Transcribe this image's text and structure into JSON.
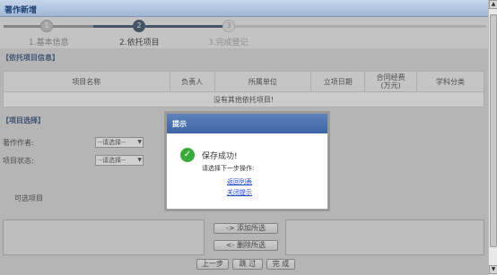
{
  "window": {
    "title": "著作新增"
  },
  "steps": [
    {
      "num": "1",
      "label": "1.基本信息"
    },
    {
      "num": "2",
      "label": "2.依托项目"
    },
    {
      "num": "3",
      "label": "3.完成登记"
    }
  ],
  "projects_section": {
    "title": "【依托项目信息】",
    "columns": [
      "项目名称",
      "负责人",
      "所属单位",
      "立项日期",
      "合同经费\n(万元)",
      "学科分类"
    ],
    "empty_text": "没有其他依托项目!"
  },
  "selection_section": {
    "title": "【项目选择】",
    "author_label": "著作作者:",
    "author_select": "--请选择--",
    "status_label": "项目状态:",
    "status_select": "--请选择--",
    "candidate_label": "可选项目"
  },
  "transfer": {
    "add_label": "-> 添加所选",
    "remove_label": "<- 删除所选"
  },
  "footer": {
    "prev_label": "上一步",
    "skip_label": "跳 过",
    "done_label": "完 成"
  },
  "dialog": {
    "title": "提示",
    "message": "保存成功!",
    "sub": "请选择下一步操作:",
    "link_return": "返回列表",
    "link_close": "关闭提示"
  },
  "colors": {
    "accent": "#1d3f73",
    "step_active": "#2a3f5f",
    "success": "#3aaa3a",
    "link": "#1d47c7"
  }
}
